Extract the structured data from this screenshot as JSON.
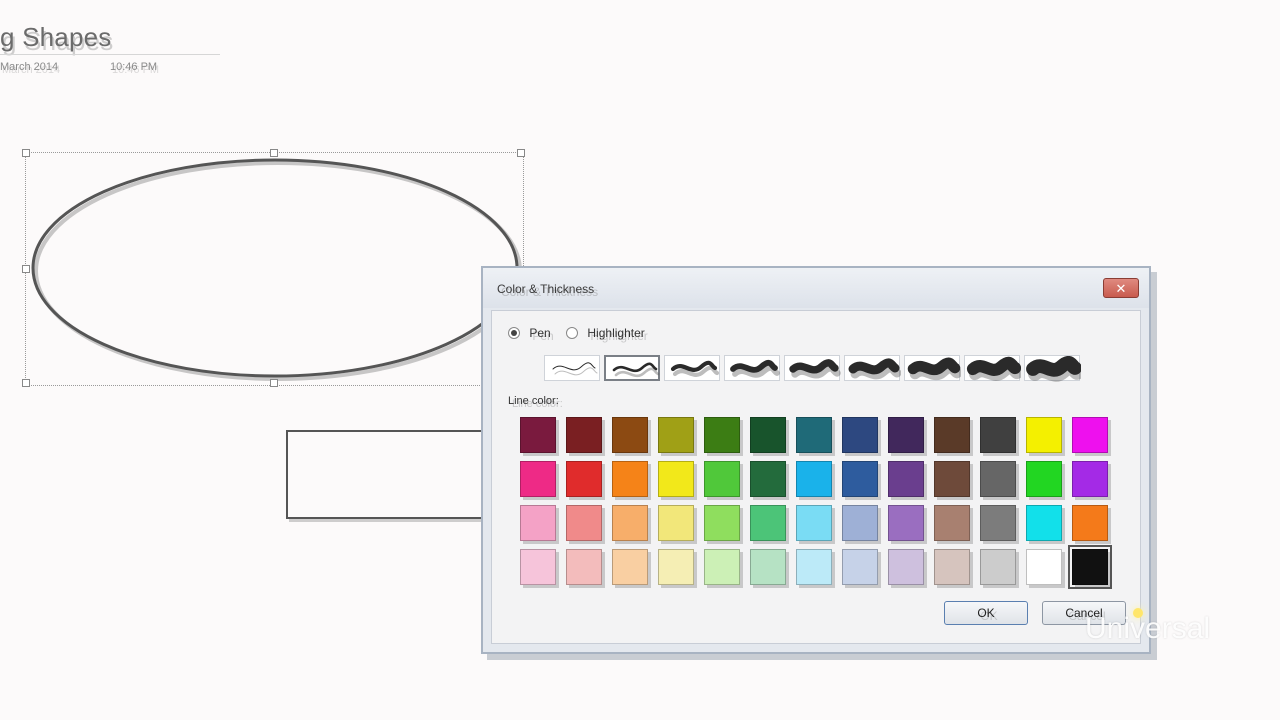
{
  "page": {
    "title": "g Shapes",
    "date": "March 2014",
    "time": "10:46 PM"
  },
  "dialog": {
    "title": "Color & Thickness",
    "close_icon": "✕",
    "pen_label": "Pen",
    "highlighter_label": "Highlighter",
    "selected_mode": "pen",
    "line_color_label": "Line color:",
    "thickness_count": 9,
    "selected_thickness_index": 1,
    "ok_label": "OK",
    "cancel_label": "Cancel"
  },
  "colors": [
    [
      "#7a1a3e",
      "#7a1f22",
      "#8c4a12",
      "#a0a016",
      "#3c7d14",
      "#18542c",
      "#1f6a78",
      "#2d4880",
      "#41285c",
      "#5a3a28",
      "#404040",
      "#f4f000",
      "#ee10ee"
    ],
    [
      "#ee2a86",
      "#e02c2c",
      "#f58318",
      "#f2e81a",
      "#50c83a",
      "#236b3c",
      "#1ab2ea",
      "#2e5c9e",
      "#6a3e8e",
      "#6e4a3a",
      "#666666",
      "#22d622",
      "#a42ae6"
    ],
    [
      "#f4a2c6",
      "#f08a8a",
      "#f7ae6a",
      "#f2e77a",
      "#8fde5e",
      "#4cc478",
      "#7adcf4",
      "#9eb0d6",
      "#9a6ec0",
      "#a88070",
      "#7c7c7c",
      "#12e0ea",
      "#f47a1a"
    ],
    [
      "#f6c4da",
      "#f3bcbc",
      "#f9cfa2",
      "#f5eeb4",
      "#ccf0b6",
      "#b6e2c4",
      "#bceaf8",
      "#c6d2e8",
      "#cec0de",
      "#d6c4be",
      "#cccccc",
      "#ffffff",
      "#111111"
    ]
  ],
  "selected_color": "#111111",
  "watermark": {
    "text": "Universal"
  }
}
